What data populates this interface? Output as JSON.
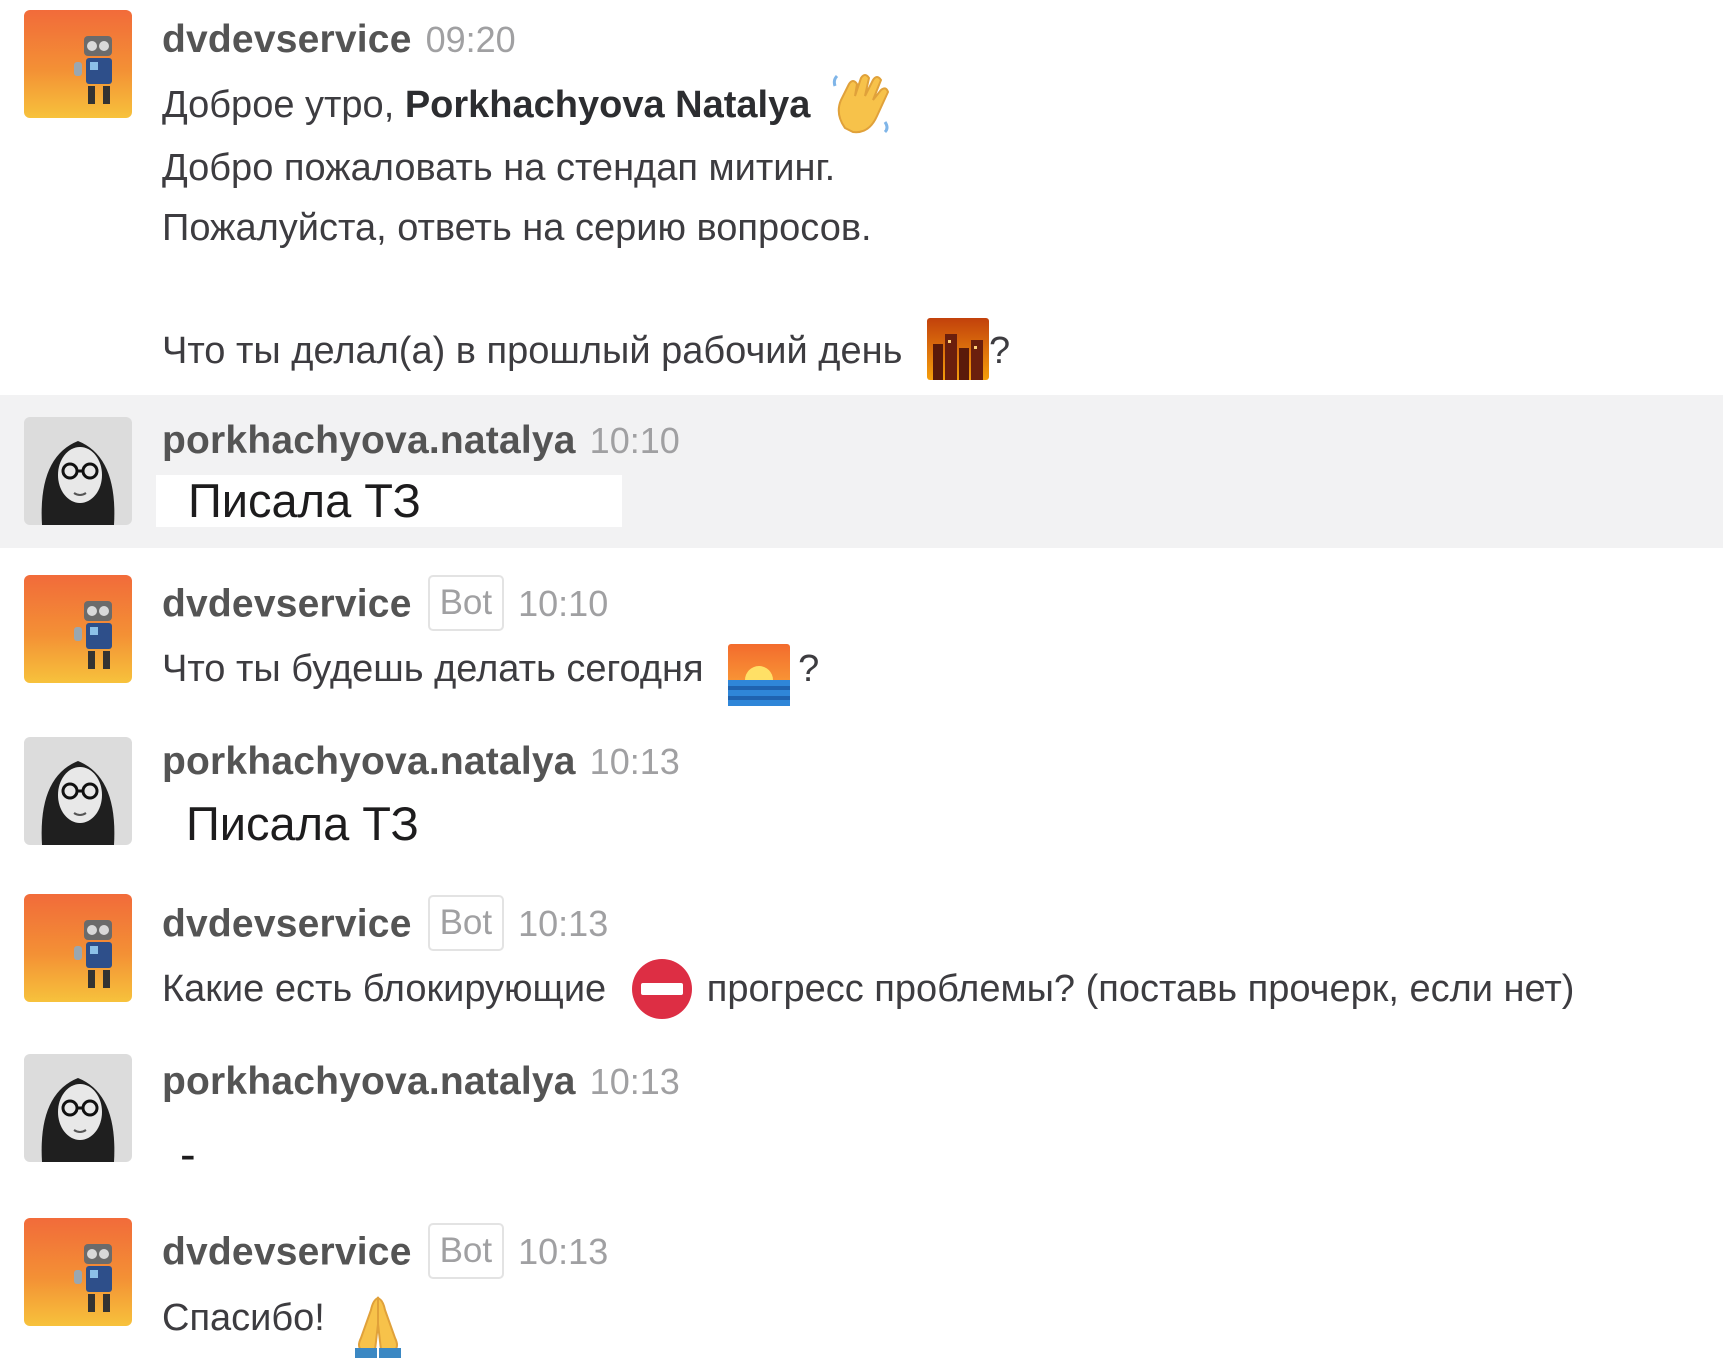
{
  "messages": [
    {
      "user": "dvdevservice",
      "bot_badge": "",
      "time": "09:20",
      "greeting_prefix": "Доброе утро, ",
      "greeting_name": "Porkhachyova Natalya",
      "greeting_emoji": "waving-hand-emoji",
      "line2": "Добро пожаловать на стендап митинг.",
      "line3": "Пожалуйста, ответь на серию вопросов.",
      "question": "Что ты делал(а) в прошлый рабочий день",
      "question_emoji": "city-sunset-emoji",
      "question_mark": "?"
    },
    {
      "user": "porkhachyova.natalya",
      "time": "10:10",
      "text": "Писала ТЗ"
    },
    {
      "user": "dvdevservice",
      "bot_badge": "Bot",
      "time": "10:10",
      "text": "Что ты будешь делать сегодня",
      "emoji": "sunrise-emoji",
      "suffix": "?"
    },
    {
      "user": "porkhachyova.natalya",
      "time": "10:13",
      "text": "Писала ТЗ"
    },
    {
      "user": "dvdevservice",
      "bot_badge": "Bot",
      "time": "10:13",
      "text": "Какие есть блокирующие",
      "emoji": "no-entry-emoji",
      "suffix": "прогресс проблемы? (поставь прочерк, если нет)"
    },
    {
      "user": "porkhachyova.natalya",
      "time": "10:13",
      "text": "-"
    },
    {
      "user": "dvdevservice",
      "bot_badge": "Bot",
      "time": "10:13",
      "text": "Спасибо!",
      "emoji": "folded-hands-emoji"
    }
  ],
  "colors": {
    "highlight_row": "#f2f2f3",
    "username": "#545454",
    "timestamp": "#a0a0a2",
    "bot_avatar_orange": "#f08a30",
    "no_entry_red": "#dd2e44"
  }
}
